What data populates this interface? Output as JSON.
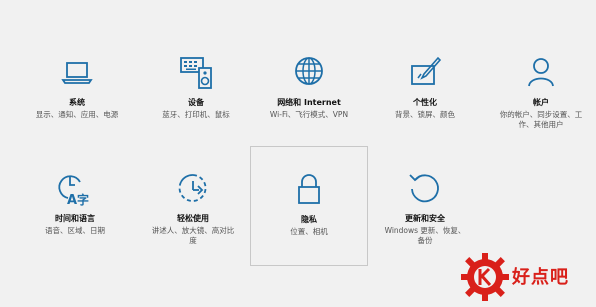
{
  "tiles": [
    {
      "title": "系统",
      "desc": "显示、通知、应用、电源",
      "icon": "laptop-icon"
    },
    {
      "title": "设备",
      "desc": "蓝牙、打印机、鼠标",
      "icon": "keyboard-speaker-icon"
    },
    {
      "title": "网络和 Internet",
      "desc": "Wi-Fi、飞行模式、VPN",
      "icon": "globe-icon"
    },
    {
      "title": "个性化",
      "desc": "背景、锁屏、颜色",
      "icon": "paint-icon"
    },
    {
      "title": "帐户",
      "desc": "你的帐户、同步设置、工作、其他用户",
      "icon": "person-icon"
    },
    {
      "title": "时间和语言",
      "desc": "语音、区域、日期",
      "icon": "time-language-icon"
    },
    {
      "title": "轻松使用",
      "desc": "讲述人、放大镜、高对比度",
      "icon": "ease-of-access-icon"
    },
    {
      "title": "隐私",
      "desc": "位置、相机",
      "icon": "lock-icon"
    },
    {
      "title": "更新和安全",
      "desc": "Windows 更新、恢复、备份",
      "icon": "refresh-icon"
    }
  ],
  "watermark": {
    "text": "好点吧",
    "color": "#d9201a"
  },
  "accent": "#1e6fa8"
}
